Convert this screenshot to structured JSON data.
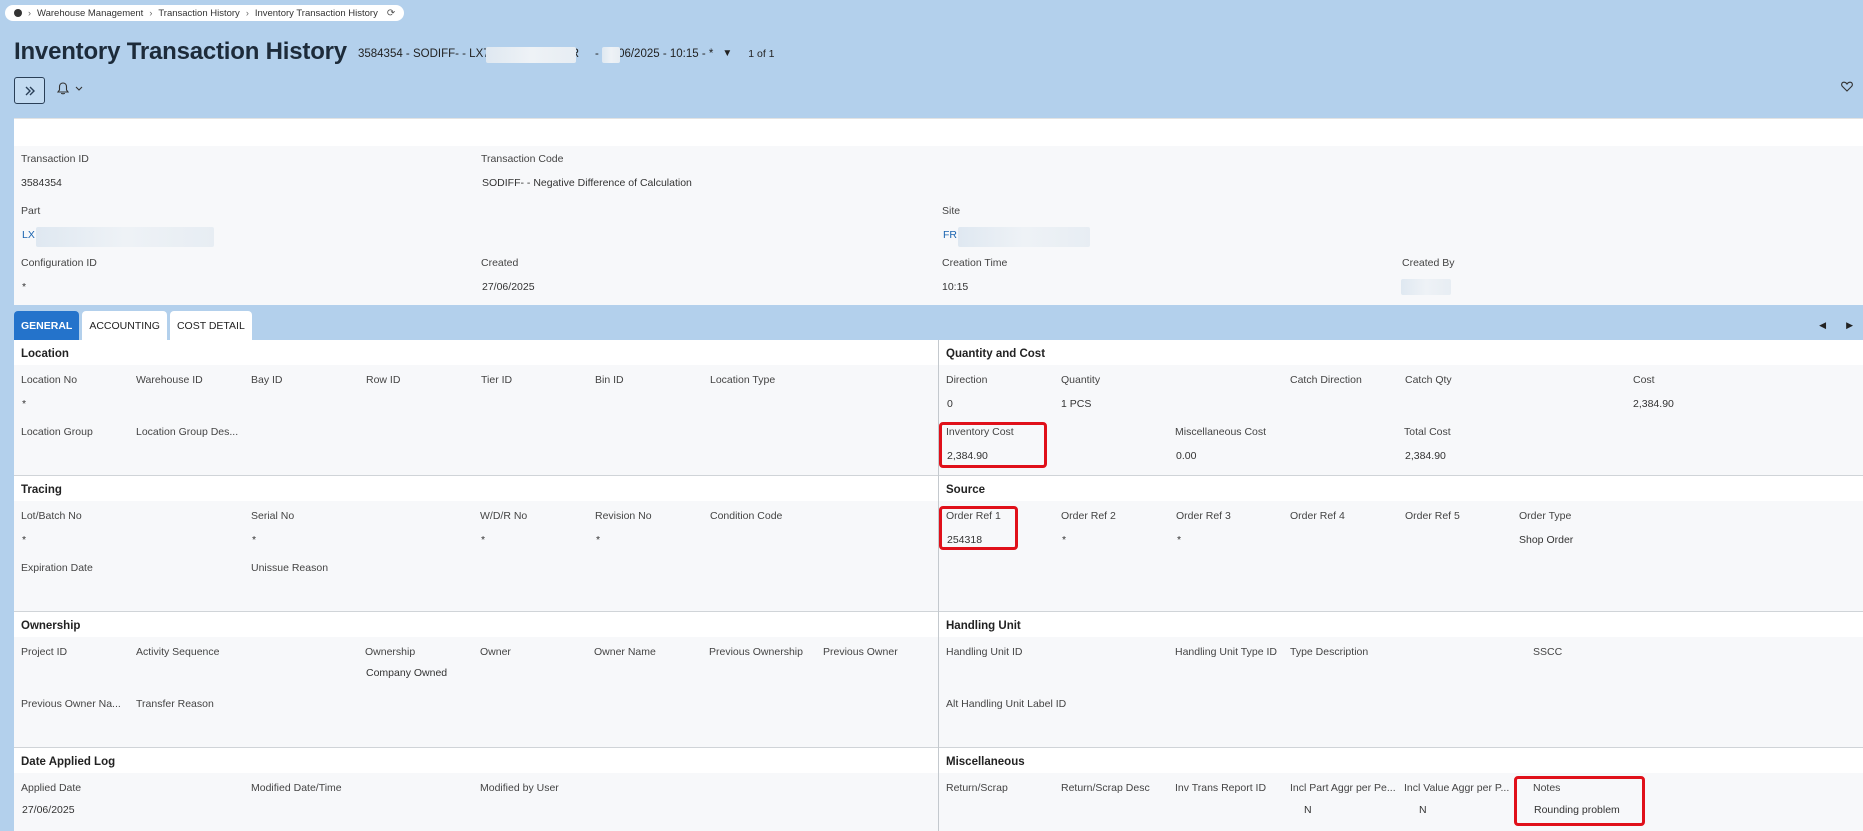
{
  "breadcrumb": [
    "Warehouse Management",
    "Transaction History",
    "Inventory Transaction History"
  ],
  "title": "Inventory Transaction History",
  "record": {
    "description": "3584354 - SODIFF- - LX7                     - FR     - 27/06/2025 - 10:15 - *",
    "count": "1 of 1"
  },
  "header": {
    "transaction_id_label": "Transaction ID",
    "transaction_id": "3584354",
    "transaction_code_label": "Transaction Code",
    "transaction_code": "SODIFF- - Negative Difference of Calculation",
    "part_label": "Part",
    "part": "LX",
    "site_label": "Site",
    "site": "FR",
    "configuration_id_label": "Configuration ID",
    "configuration_id": "*",
    "created_label": "Created",
    "created": "27/06/2025",
    "creation_time_label": "Creation Time",
    "creation_time": "10:15",
    "created_by_label": "Created By"
  },
  "tabs": [
    "GENERAL",
    "ACCOUNTING",
    "COST DETAIL"
  ],
  "location": {
    "title": "Location",
    "location_no": "Location No",
    "location_no_value": "*",
    "warehouse_id": "Warehouse ID",
    "bay_id": "Bay ID",
    "row_id": "Row ID",
    "tier_id": "Tier ID",
    "bin_id": "Bin ID",
    "location_type": "Location Type",
    "location_group": "Location Group",
    "location_group_desc": "Location Group Des..."
  },
  "quantity": {
    "title": "Quantity and Cost",
    "direction": "Direction",
    "direction_value": "0",
    "quantity": "Quantity",
    "quantity_value": "1 PCS",
    "catch_direction": "Catch Direction",
    "catch_qty": "Catch Qty",
    "cost": "Cost",
    "cost_value": "2,384.90",
    "inventory_cost": "Inventory Cost",
    "inventory_cost_value": "2,384.90",
    "misc_cost": "Miscellaneous Cost",
    "misc_cost_value": "0.00",
    "total_cost": "Total Cost",
    "total_cost_value": "2,384.90"
  },
  "tracing": {
    "title": "Tracing",
    "lot_batch": "Lot/Batch No",
    "lot_batch_value": "*",
    "serial": "Serial No",
    "serial_value": "*",
    "wdr": "W/D/R No",
    "wdr_value": "*",
    "revision": "Revision No",
    "revision_value": "*",
    "condition": "Condition Code",
    "expiration": "Expiration Date",
    "unissue": "Unissue Reason"
  },
  "source": {
    "title": "Source",
    "ref1": "Order Ref 1",
    "ref1_value": "254318",
    "ref2": "Order Ref 2",
    "ref2_value": "*",
    "ref3": "Order Ref 3",
    "ref3_value": "*",
    "ref4": "Order Ref 4",
    "ref5": "Order Ref 5",
    "order_type": "Order Type",
    "order_type_value": "Shop Order"
  },
  "ownership": {
    "title": "Ownership",
    "project_id": "Project ID",
    "activity_seq": "Activity Sequence",
    "ownership": "Ownership",
    "ownership_value": "Company Owned",
    "owner": "Owner",
    "owner_name": "Owner Name",
    "prev_ownership": "Previous Ownership",
    "prev_owner": "Previous Owner",
    "prev_owner_name": "Previous Owner Na...",
    "transfer_reason": "Transfer Reason"
  },
  "handling": {
    "title": "Handling Unit",
    "hu_id": "Handling Unit ID",
    "hu_type": "Handling Unit Type ID",
    "type_desc": "Type Description",
    "sscc": "SSCC",
    "alt_label": "Alt Handling Unit Label ID"
  },
  "date_log": {
    "title": "Date Applied Log",
    "applied": "Applied Date",
    "applied_value": "27/06/2025",
    "modified": "Modified Date/Time",
    "modified_by": "Modified by User"
  },
  "misc": {
    "title": "Miscellaneous",
    "return_scrap": "Return/Scrap",
    "return_scrap_desc": "Return/Scrap Desc",
    "inv_trans_report": "Inv Trans Report ID",
    "incl_part": "Incl Part Aggr per Pe...",
    "incl_part_value": "N",
    "incl_value": "Incl Value Aggr per P...",
    "incl_value_value": "N",
    "notes": "Notes",
    "notes_value": "Rounding problem"
  },
  "colors": {
    "accent": "#2473cb",
    "highlight": "#e0101a",
    "background": "#b3d0ec"
  }
}
